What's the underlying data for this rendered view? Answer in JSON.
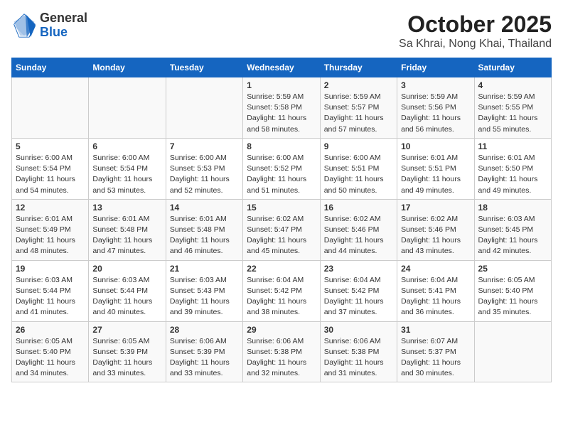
{
  "logo": {
    "general": "General",
    "blue": "Blue"
  },
  "title": "October 2025",
  "subtitle": "Sa Khrai, Nong Khai, Thailand",
  "days_header": [
    "Sunday",
    "Monday",
    "Tuesday",
    "Wednesday",
    "Thursday",
    "Friday",
    "Saturday"
  ],
  "weeks": [
    [
      {
        "day": "",
        "info": ""
      },
      {
        "day": "",
        "info": ""
      },
      {
        "day": "",
        "info": ""
      },
      {
        "day": "1",
        "info": "Sunrise: 5:59 AM\nSunset: 5:58 PM\nDaylight: 11 hours and 58 minutes."
      },
      {
        "day": "2",
        "info": "Sunrise: 5:59 AM\nSunset: 5:57 PM\nDaylight: 11 hours and 57 minutes."
      },
      {
        "day": "3",
        "info": "Sunrise: 5:59 AM\nSunset: 5:56 PM\nDaylight: 11 hours and 56 minutes."
      },
      {
        "day": "4",
        "info": "Sunrise: 5:59 AM\nSunset: 5:55 PM\nDaylight: 11 hours and 55 minutes."
      }
    ],
    [
      {
        "day": "5",
        "info": "Sunrise: 6:00 AM\nSunset: 5:54 PM\nDaylight: 11 hours and 54 minutes."
      },
      {
        "day": "6",
        "info": "Sunrise: 6:00 AM\nSunset: 5:54 PM\nDaylight: 11 hours and 53 minutes."
      },
      {
        "day": "7",
        "info": "Sunrise: 6:00 AM\nSunset: 5:53 PM\nDaylight: 11 hours and 52 minutes."
      },
      {
        "day": "8",
        "info": "Sunrise: 6:00 AM\nSunset: 5:52 PM\nDaylight: 11 hours and 51 minutes."
      },
      {
        "day": "9",
        "info": "Sunrise: 6:00 AM\nSunset: 5:51 PM\nDaylight: 11 hours and 50 minutes."
      },
      {
        "day": "10",
        "info": "Sunrise: 6:01 AM\nSunset: 5:51 PM\nDaylight: 11 hours and 49 minutes."
      },
      {
        "day": "11",
        "info": "Sunrise: 6:01 AM\nSunset: 5:50 PM\nDaylight: 11 hours and 49 minutes."
      }
    ],
    [
      {
        "day": "12",
        "info": "Sunrise: 6:01 AM\nSunset: 5:49 PM\nDaylight: 11 hours and 48 minutes."
      },
      {
        "day": "13",
        "info": "Sunrise: 6:01 AM\nSunset: 5:48 PM\nDaylight: 11 hours and 47 minutes."
      },
      {
        "day": "14",
        "info": "Sunrise: 6:01 AM\nSunset: 5:48 PM\nDaylight: 11 hours and 46 minutes."
      },
      {
        "day": "15",
        "info": "Sunrise: 6:02 AM\nSunset: 5:47 PM\nDaylight: 11 hours and 45 minutes."
      },
      {
        "day": "16",
        "info": "Sunrise: 6:02 AM\nSunset: 5:46 PM\nDaylight: 11 hours and 44 minutes."
      },
      {
        "day": "17",
        "info": "Sunrise: 6:02 AM\nSunset: 5:46 PM\nDaylight: 11 hours and 43 minutes."
      },
      {
        "day": "18",
        "info": "Sunrise: 6:03 AM\nSunset: 5:45 PM\nDaylight: 11 hours and 42 minutes."
      }
    ],
    [
      {
        "day": "19",
        "info": "Sunrise: 6:03 AM\nSunset: 5:44 PM\nDaylight: 11 hours and 41 minutes."
      },
      {
        "day": "20",
        "info": "Sunrise: 6:03 AM\nSunset: 5:44 PM\nDaylight: 11 hours and 40 minutes."
      },
      {
        "day": "21",
        "info": "Sunrise: 6:03 AM\nSunset: 5:43 PM\nDaylight: 11 hours and 39 minutes."
      },
      {
        "day": "22",
        "info": "Sunrise: 6:04 AM\nSunset: 5:42 PM\nDaylight: 11 hours and 38 minutes."
      },
      {
        "day": "23",
        "info": "Sunrise: 6:04 AM\nSunset: 5:42 PM\nDaylight: 11 hours and 37 minutes."
      },
      {
        "day": "24",
        "info": "Sunrise: 6:04 AM\nSunset: 5:41 PM\nDaylight: 11 hours and 36 minutes."
      },
      {
        "day": "25",
        "info": "Sunrise: 6:05 AM\nSunset: 5:40 PM\nDaylight: 11 hours and 35 minutes."
      }
    ],
    [
      {
        "day": "26",
        "info": "Sunrise: 6:05 AM\nSunset: 5:40 PM\nDaylight: 11 hours and 34 minutes."
      },
      {
        "day": "27",
        "info": "Sunrise: 6:05 AM\nSunset: 5:39 PM\nDaylight: 11 hours and 33 minutes."
      },
      {
        "day": "28",
        "info": "Sunrise: 6:06 AM\nSunset: 5:39 PM\nDaylight: 11 hours and 33 minutes."
      },
      {
        "day": "29",
        "info": "Sunrise: 6:06 AM\nSunset: 5:38 PM\nDaylight: 11 hours and 32 minutes."
      },
      {
        "day": "30",
        "info": "Sunrise: 6:06 AM\nSunset: 5:38 PM\nDaylight: 11 hours and 31 minutes."
      },
      {
        "day": "31",
        "info": "Sunrise: 6:07 AM\nSunset: 5:37 PM\nDaylight: 11 hours and 30 minutes."
      },
      {
        "day": "",
        "info": ""
      }
    ]
  ]
}
